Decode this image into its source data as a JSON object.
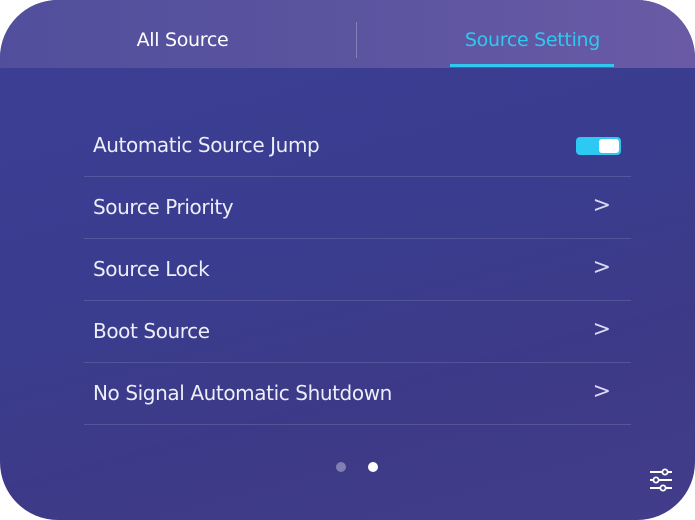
{
  "tabs": [
    {
      "label": "All Source",
      "active": false
    },
    {
      "label": "Source Setting",
      "active": true
    }
  ],
  "settings": {
    "rows": [
      {
        "label": "Automatic Source Jump",
        "control": "toggle",
        "enabled": true
      },
      {
        "label": "Source Priority",
        "control": "chevron",
        "chevron": ">"
      },
      {
        "label": "Source Lock",
        "control": "chevron",
        "chevron": ">"
      },
      {
        "label": "Boot Source",
        "control": "chevron",
        "chevron": ">"
      },
      {
        "label": "No Signal Automatic Shutdown",
        "control": "chevron",
        "chevron": ">"
      }
    ]
  },
  "pager": {
    "total": 2,
    "active_index": 1
  },
  "icons": {
    "bottom_right": "sliders-icon"
  },
  "colors": {
    "accent": "#31c8f0",
    "background_start": "#3c3f95",
    "background_end": "#423d8b",
    "text": "#eceef8"
  }
}
